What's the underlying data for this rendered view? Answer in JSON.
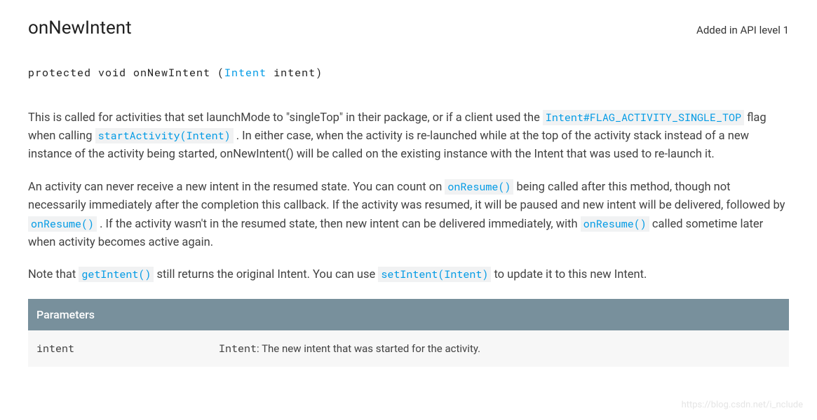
{
  "header": {
    "title": "onNewIntent",
    "api_level": "Added in API level 1"
  },
  "signature": {
    "prefix": "protected void onNewIntent (",
    "param_type": "Intent",
    "param_name": " intent)",
    "type_href": "#"
  },
  "para1": {
    "t1": "This is called for activities that set launchMode to \"singleTop\" in their package, or if a client used the ",
    "c1": "Intent#FLAG_ACTIVITY_SINGLE_TOP",
    "t2": " flag when calling ",
    "c2": "startActivity(Intent)",
    "t3": ". In either case, when the activity is re-launched while at the top of the activity stack instead of a new instance of the activity being started, onNewIntent() will be called on the existing instance with the Intent that was used to re-launch it."
  },
  "para2": {
    "t1": "An activity can never receive a new intent in the resumed state. You can count on ",
    "c1": "onResume()",
    "t2": " being called after this method, though not necessarily immediately after the completion this callback. If the activity was resumed, it will be paused and new intent will be delivered, followed by ",
    "c2": "onResume()",
    "t3": ". If the activity wasn't in the resumed state, then new intent can be delivered immediately, with ",
    "c3": "onResume()",
    "t4": " called sometime later when activity becomes active again."
  },
  "para3": {
    "t1": "Note that ",
    "c1": "getIntent()",
    "t2": " still returns the original Intent. You can use ",
    "c2": "setIntent(Intent)",
    "t3": " to update it to this new Intent."
  },
  "params": {
    "header": "Parameters",
    "rows": [
      {
        "name": "intent",
        "type": "Intent",
        "desc": ": The new intent that was started for the activity."
      }
    ]
  },
  "watermark": "https://blog.csdn.net/i_nclude"
}
